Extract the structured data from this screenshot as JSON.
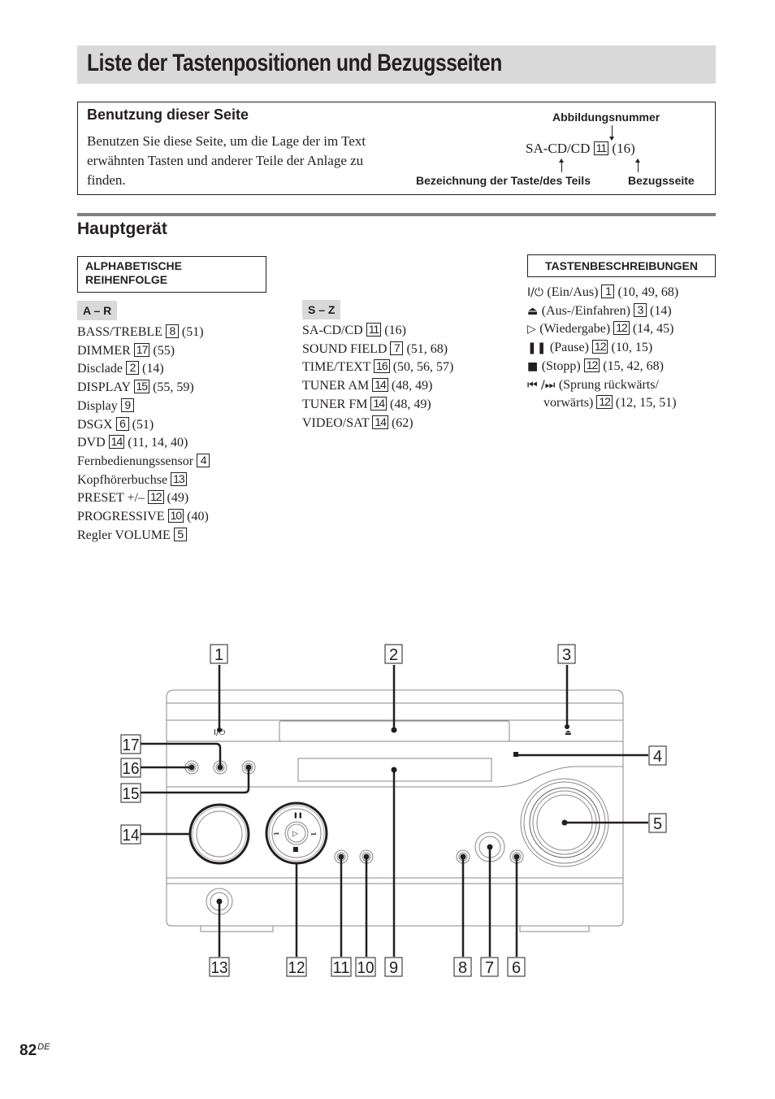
{
  "page": {
    "title": "Liste der Tastenpositionen und Bezugsseiten",
    "page_number": "82",
    "page_suffix": "DE"
  },
  "usage": {
    "heading": "Benutzung dieser Seite",
    "text": "Benutzen Sie diese Seite, um die Lage der im Text erwähnten Tasten und anderer Teile der Anlage zu finden.",
    "example_name": "SA-CD/CD",
    "example_num": "11",
    "example_ref": "(16)",
    "label_figure_number": "Abbildungsnummer",
    "label_part_name": "Bezeichnung der Taste/des Teils",
    "label_ref_page": "Bezugsseite"
  },
  "section": {
    "title": "Hauptgerät",
    "alpha_box": "ALPHABETISCHE REIHENFOLGE",
    "desc_box": "TASTENBESCHREIBUNGEN"
  },
  "alpha_a_r": {
    "tag": "A – R",
    "items": [
      {
        "name": "BASS/TREBLE",
        "num": "8",
        "refs": "(51)"
      },
      {
        "name": "DIMMER",
        "num": "17",
        "refs": "(55)"
      },
      {
        "name": "Disclade",
        "num": "2",
        "refs": "(14)"
      },
      {
        "name": "DISPLAY",
        "num": "15",
        "refs": "(55, 59)"
      },
      {
        "name": "Display",
        "num": "9",
        "refs": ""
      },
      {
        "name": "DSGX",
        "num": "6",
        "refs": "(51)"
      },
      {
        "name": "DVD",
        "num": "14",
        "refs": "(11, 14, 40)"
      },
      {
        "name": "Fernbedienungssensor",
        "num": "4",
        "refs": ""
      },
      {
        "name": "Kopfhörerbuchse",
        "num": "13",
        "refs": ""
      },
      {
        "name": "PRESET +/–",
        "num": "12",
        "refs": "(49)"
      },
      {
        "name": "PROGRESSIVE",
        "num": "10",
        "refs": "(40)"
      },
      {
        "name": "Regler VOLUME",
        "num": "5",
        "refs": ""
      }
    ]
  },
  "alpha_s_z": {
    "tag": "S – Z",
    "items": [
      {
        "name": "SA-CD/CD",
        "num": "11",
        "refs": "(16)"
      },
      {
        "name": "SOUND FIELD",
        "num": "7",
        "refs": "(51, 68)"
      },
      {
        "name": "TIME/TEXT",
        "num": "16",
        "refs": "(50, 56, 57)"
      },
      {
        "name": "TUNER AM",
        "num": "14",
        "refs": "(48, 49)"
      },
      {
        "name": "TUNER FM",
        "num": "14",
        "refs": "(48, 49)"
      },
      {
        "name": "VIDEO/SAT",
        "num": "14",
        "refs": "(62)"
      }
    ]
  },
  "button_descriptions": [
    {
      "symbol": "I/⏻",
      "icon": "power-icon",
      "name": "(Ein/Aus)",
      "num": "1",
      "refs": "(10, 49, 68)"
    },
    {
      "symbol": "⏏",
      "icon": "eject-icon",
      "name": "(Aus-/Einfahren)",
      "num": "3",
      "refs": "(14)"
    },
    {
      "symbol": "▷",
      "icon": "play-icon",
      "name": "(Wiedergabe)",
      "num": "12",
      "refs": "(14, 45)"
    },
    {
      "symbol": "❚❚",
      "icon": "pause-icon",
      "name": "(Pause)",
      "num": "12",
      "refs": "(10, 15)"
    },
    {
      "symbol": "■",
      "icon": "stop-icon",
      "name": "(Stopp)",
      "num": "12",
      "refs": "(15, 42, 68)"
    },
    {
      "symbol": "⏮ /⏭",
      "icon": "skip-icon",
      "name": "(Sprung rückwärts/",
      "name_cont": "vorwärts)",
      "num": "12",
      "refs": "(12, 15, 51)"
    }
  ],
  "diagram": {
    "callouts": [
      "1",
      "2",
      "3",
      "4",
      "5",
      "6",
      "7",
      "8",
      "9",
      "10",
      "11",
      "12",
      "13",
      "14",
      "15",
      "16",
      "17"
    ]
  }
}
